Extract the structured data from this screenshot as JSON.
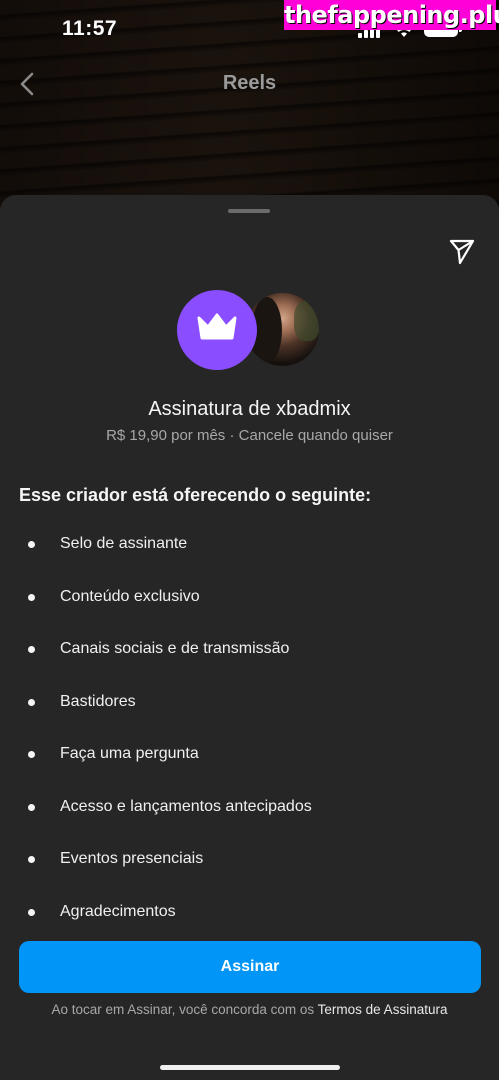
{
  "status_bar": {
    "time": "11:57",
    "battery": "99"
  },
  "watermark": "thefappening.plus",
  "header": {
    "title": "Reels",
    "back_icon": "chevron-left-icon"
  },
  "sheet": {
    "share_icon": "paper-plane-icon",
    "badge_icon": "crown-icon",
    "badge_color": "#8a4dff",
    "title": "Assinatura de xbadmix",
    "subtitle": "R$ 19,90 por mês · Cancele quando quiser",
    "benefits_heading": "Esse criador está oferecendo o seguinte:",
    "benefits": [
      {
        "label": "Selo de assinante"
      },
      {
        "label": "Conteúdo exclusivo"
      },
      {
        "label": "Canais sociais e de transmissão"
      },
      {
        "label": "Bastidores"
      },
      {
        "label": "Faça uma pergunta"
      },
      {
        "label": "Acesso e lançamentos antecipados"
      },
      {
        "label": "Eventos presenciais"
      },
      {
        "label": "Agradecimentos"
      }
    ],
    "subscribe_label": "Assinar",
    "subscribe_color": "#0095f6",
    "terms_prefix": "Ao tocar em Assinar, você concorda com os ",
    "terms_link": "Termos de Assinatura"
  }
}
